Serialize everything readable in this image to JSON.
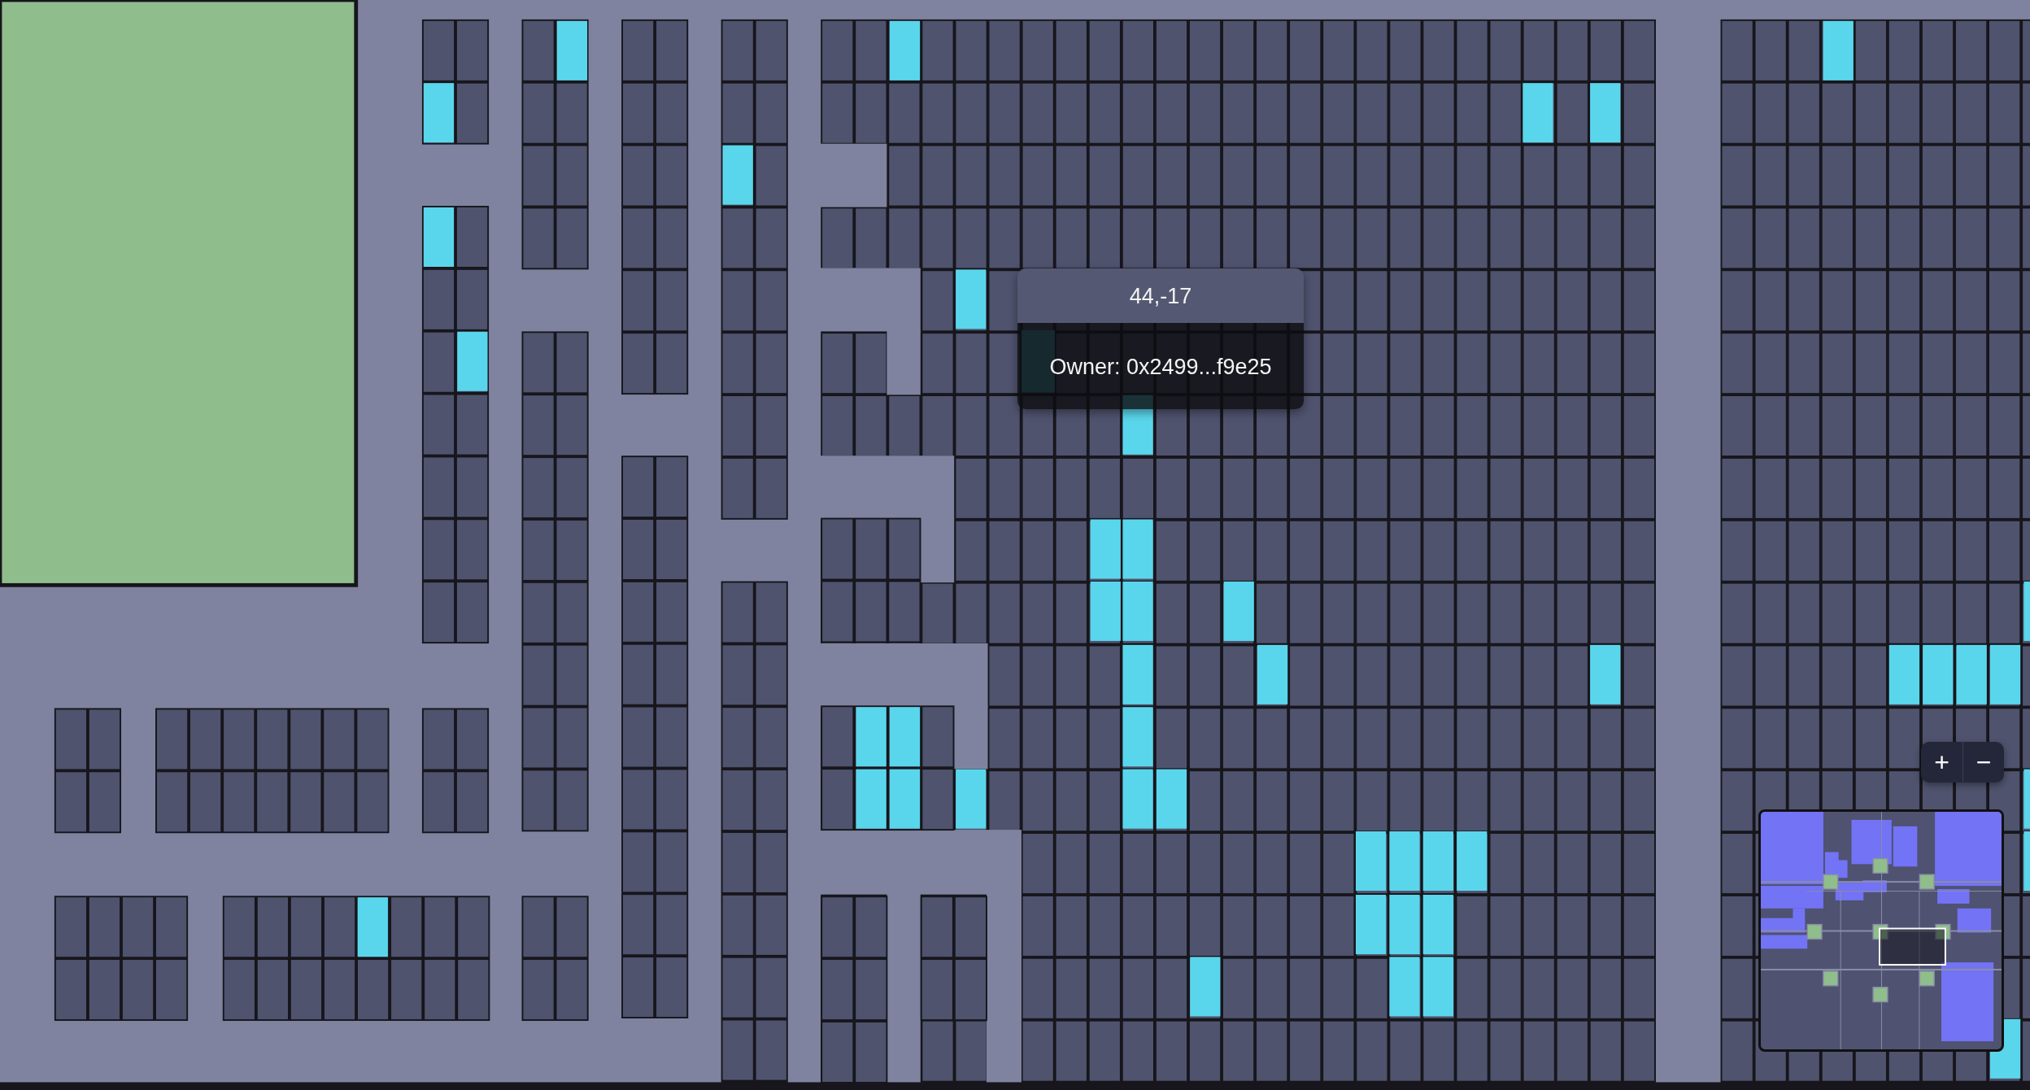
{
  "tooltip": {
    "coordinates": "44,-17",
    "owner": "Owner: 0x2499...f9e25"
  },
  "zoom_controls": [
    "+",
    "−"
  ]
}
